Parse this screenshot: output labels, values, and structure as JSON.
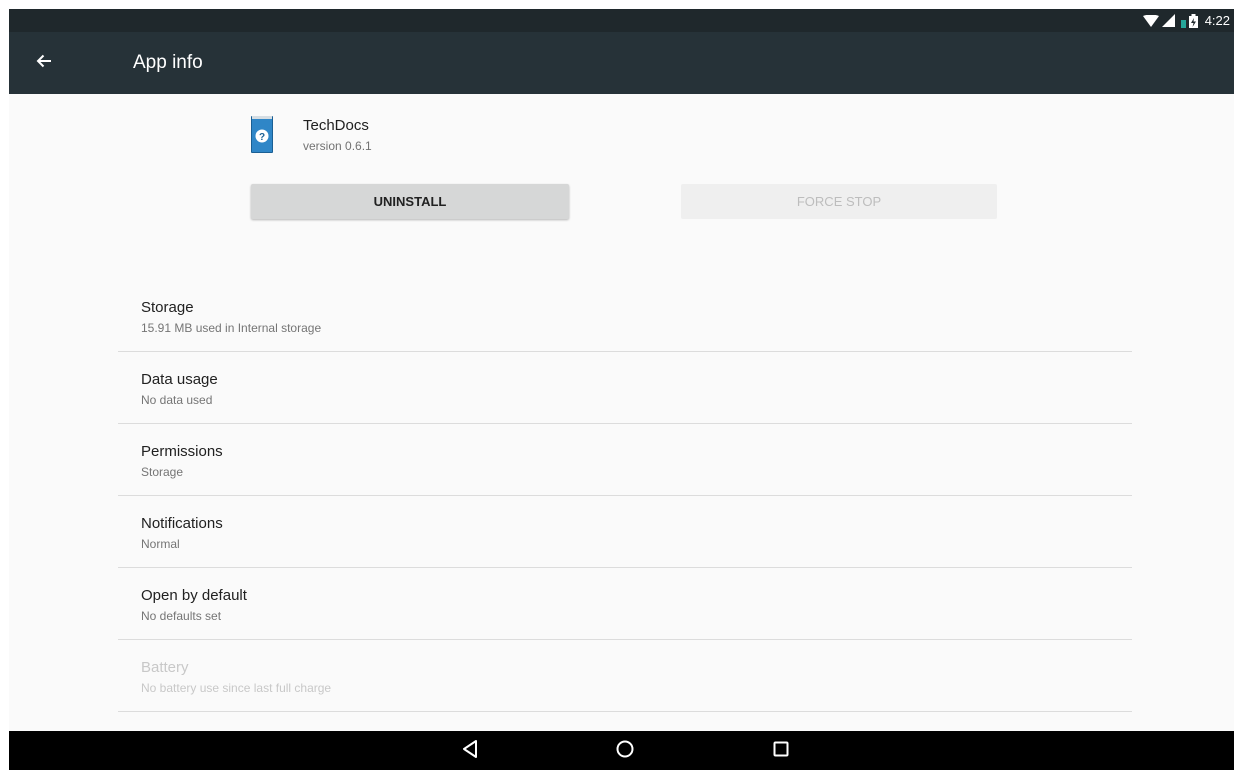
{
  "status_bar": {
    "time": "4:22",
    "icons": [
      "wifi-icon",
      "cell-signal-icon",
      "battery-charging-icon"
    ]
  },
  "app_bar": {
    "title": "App info",
    "back_icon": "arrow-back-icon"
  },
  "app": {
    "name": "TechDocs",
    "version": "version 0.6.1",
    "icon": "book-question-icon",
    "icon_color": "#2477b8"
  },
  "buttons": {
    "uninstall": "UNINSTALL",
    "force_stop": "FORCE STOP"
  },
  "settings": [
    {
      "title": "Storage",
      "subtitle": "15.91 MB used in Internal storage",
      "enabled": true
    },
    {
      "title": "Data usage",
      "subtitle": "No data used",
      "enabled": true
    },
    {
      "title": "Permissions",
      "subtitle": "Storage",
      "enabled": true
    },
    {
      "title": "Notifications",
      "subtitle": "Normal",
      "enabled": true
    },
    {
      "title": "Open by default",
      "subtitle": "No defaults set",
      "enabled": true
    },
    {
      "title": "Battery",
      "subtitle": "No battery use since last full charge",
      "enabled": false
    }
  ],
  "nav_bar": {
    "icons": [
      "back-triangle-icon",
      "home-circle-icon",
      "recents-square-icon"
    ]
  },
  "colors": {
    "app_bar": "#263238",
    "status_bar": "#1f282c",
    "background": "#fafafa",
    "battery_accent": "#26a69a"
  }
}
